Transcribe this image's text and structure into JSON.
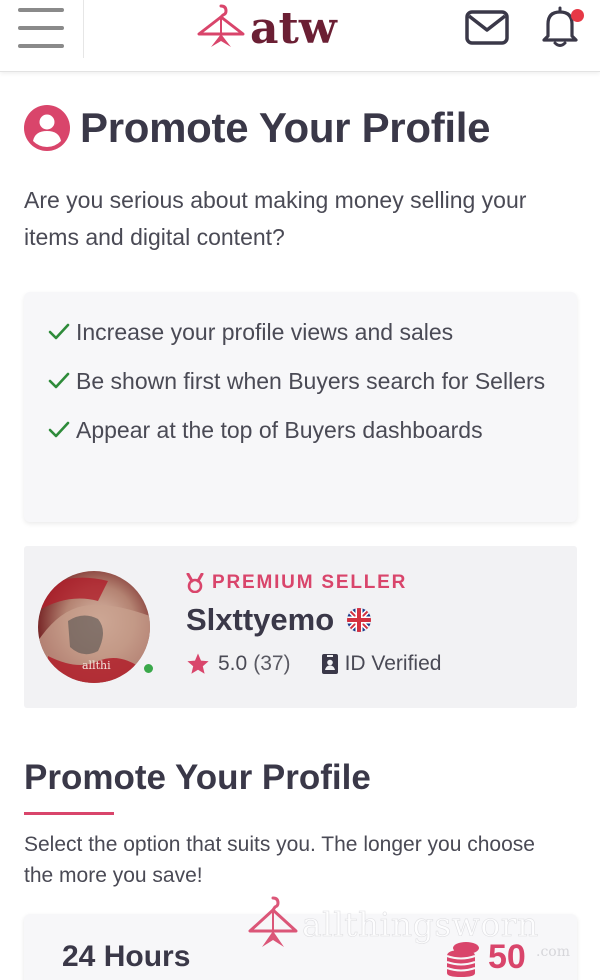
{
  "header": {
    "logo_text": "atw",
    "brand_color": "#6b1f34",
    "accent_color": "#d9456b",
    "notification_dot_color": "#e63946",
    "icons": [
      "menu-icon",
      "hanger-logo-icon",
      "mail-icon",
      "bell-icon"
    ]
  },
  "page": {
    "title": "Promote Your Profile",
    "intro": "Are you serious about making money selling your items and digital content?"
  },
  "benefits": [
    "Increase your profile views and sales",
    "Be shown first when Buyers search for Sellers",
    "Appear at the top of Buyers dashboards"
  ],
  "seller": {
    "badge": "PREMIUM SELLER",
    "name": "Slxttyemo",
    "country_flag": "uk-flag-icon",
    "rating": "5.0",
    "rating_count": "(37)",
    "verified_label": "ID Verified",
    "avatar_watermark": "allthi",
    "online": true
  },
  "promote": {
    "title": "Promote Your Profile",
    "subtitle": "Select the option that suits you. The longer you choose the more you save!",
    "options": [
      {
        "duration": "24 Hours",
        "price": "50"
      }
    ]
  },
  "watermark": {
    "text": "allthingsworn",
    "sub": ".com"
  }
}
